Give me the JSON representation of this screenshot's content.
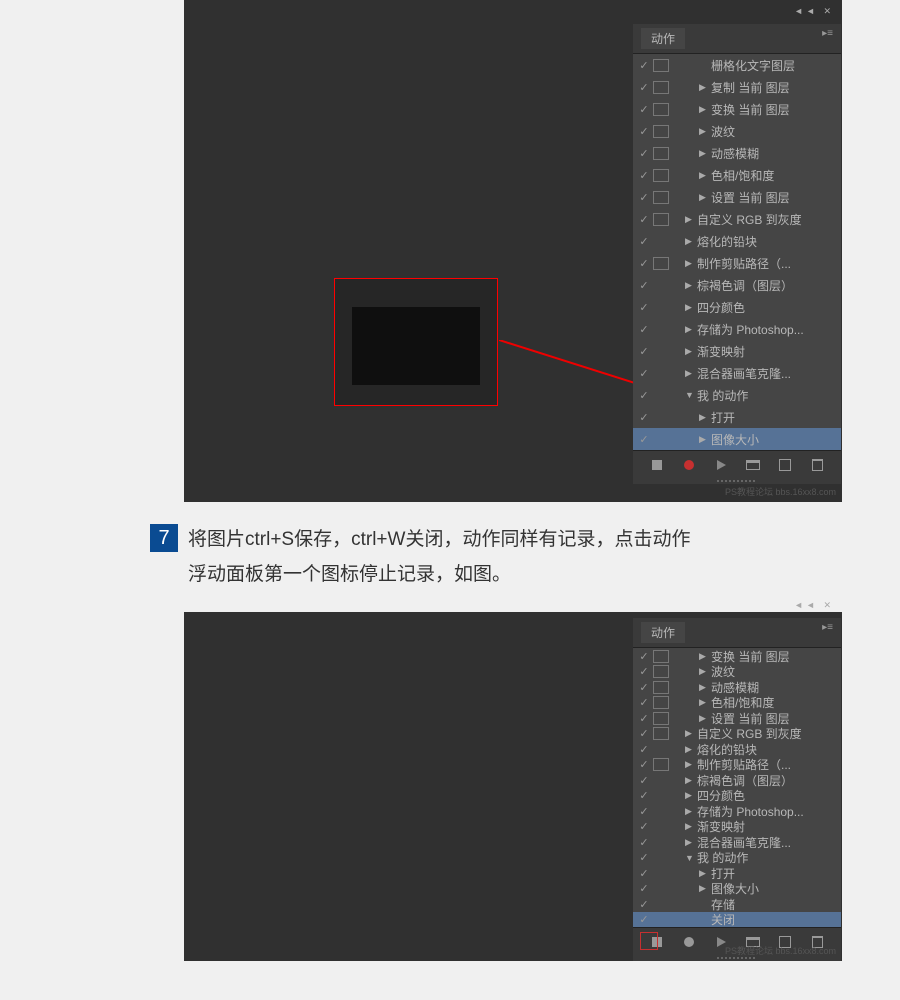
{
  "panel": {
    "title": "动作",
    "collapse": "◄◄  ✕"
  },
  "actions1": [
    {
      "indent": 2,
      "tri": "",
      "label": "栅格化文字图层",
      "modal": true
    },
    {
      "indent": 2,
      "tri": "▶",
      "label": "复制 当前 图层",
      "modal": true
    },
    {
      "indent": 2,
      "tri": "▶",
      "label": "变换 当前 图层",
      "modal": true
    },
    {
      "indent": 2,
      "tri": "▶",
      "label": "波纹",
      "modal": true
    },
    {
      "indent": 2,
      "tri": "▶",
      "label": "动感模糊",
      "modal": true
    },
    {
      "indent": 2,
      "tri": "▶",
      "label": "色相/饱和度",
      "modal": true
    },
    {
      "indent": 2,
      "tri": "▶",
      "label": "设置 当前 图层",
      "modal": true
    },
    {
      "indent": 1,
      "tri": "▶",
      "label": "自定义 RGB 到灰度",
      "modal": true
    },
    {
      "indent": 1,
      "tri": "▶",
      "label": "熔化的铅块",
      "modal": false
    },
    {
      "indent": 1,
      "tri": "▶",
      "label": "制作剪贴路径（...",
      "modal": true
    },
    {
      "indent": 1,
      "tri": "▶",
      "label": "棕褐色调（图层）",
      "modal": false
    },
    {
      "indent": 1,
      "tri": "▶",
      "label": "四分颜色",
      "modal": false
    },
    {
      "indent": 1,
      "tri": "▶",
      "label": "存储为 Photoshop...",
      "modal": false
    },
    {
      "indent": 1,
      "tri": "▶",
      "label": "渐变映射",
      "modal": false
    },
    {
      "indent": 1,
      "tri": "▶",
      "label": "混合器画笔克隆...",
      "modal": false
    },
    {
      "indent": 1,
      "tri": "▼",
      "label": "我 的动作",
      "modal": false
    },
    {
      "indent": 2,
      "tri": "▶",
      "label": "打开",
      "modal": false
    },
    {
      "indent": 2,
      "tri": "▶",
      "label": "图像大小",
      "modal": false,
      "sel": true
    }
  ],
  "actions2": [
    {
      "indent": 2,
      "tri": "▶",
      "label": "变换 当前 图层",
      "modal": true
    },
    {
      "indent": 2,
      "tri": "▶",
      "label": "波纹",
      "modal": true
    },
    {
      "indent": 2,
      "tri": "▶",
      "label": "动感模糊",
      "modal": true
    },
    {
      "indent": 2,
      "tri": "▶",
      "label": "色相/饱和度",
      "modal": true
    },
    {
      "indent": 2,
      "tri": "▶",
      "label": "设置 当前 图层",
      "modal": true
    },
    {
      "indent": 1,
      "tri": "▶",
      "label": "自定义 RGB 到灰度",
      "modal": true
    },
    {
      "indent": 1,
      "tri": "▶",
      "label": "熔化的铅块",
      "modal": false
    },
    {
      "indent": 1,
      "tri": "▶",
      "label": "制作剪贴路径（...",
      "modal": true
    },
    {
      "indent": 1,
      "tri": "▶",
      "label": "棕褐色调（图层）",
      "modal": false
    },
    {
      "indent": 1,
      "tri": "▶",
      "label": "四分颜色",
      "modal": false
    },
    {
      "indent": 1,
      "tri": "▶",
      "label": "存储为 Photoshop...",
      "modal": false
    },
    {
      "indent": 1,
      "tri": "▶",
      "label": "渐变映射",
      "modal": false
    },
    {
      "indent": 1,
      "tri": "▶",
      "label": "混合器画笔克隆...",
      "modal": false
    },
    {
      "indent": 1,
      "tri": "▼",
      "label": "我 的动作",
      "modal": false
    },
    {
      "indent": 2,
      "tri": "▶",
      "label": "打开",
      "modal": false
    },
    {
      "indent": 2,
      "tri": "▶",
      "label": "图像大小",
      "modal": false
    },
    {
      "indent": 2,
      "tri": "",
      "label": "存储",
      "modal": false
    },
    {
      "indent": 2,
      "tri": "",
      "label": "关闭",
      "modal": false,
      "sel": true
    }
  ],
  "step": {
    "num": "7",
    "text": "将图片ctrl+S保存，ctrl+W关闭，动作同样有记录，点击动作浮动面板第一个图标停止记录，如图。"
  },
  "watermark": "PS教程论坛  bbs.16xx8.com"
}
